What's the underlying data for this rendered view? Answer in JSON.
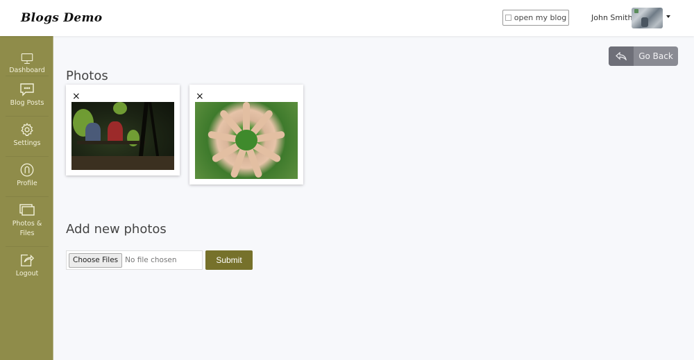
{
  "header": {
    "logo": "Blogs Demo",
    "open_blog_label": "open my blog",
    "open_blog_icon": "external-link-icon",
    "user_name": "John Smith",
    "avatar_alt": "user-avatar-photo",
    "dropdown_icon": "caret-down-icon"
  },
  "sidebar": {
    "items": [
      {
        "label": "Dashboard",
        "icon": "monitor-icon"
      },
      {
        "label": "Blog Posts",
        "icon": "chat-bubble-icon"
      },
      {
        "label": "Settings",
        "icon": "gear-icon"
      },
      {
        "label": "Profile",
        "icon": "user-circle-icon"
      },
      {
        "label": "Photos & Files",
        "icon": "photos-stack-icon"
      },
      {
        "label": "Logout",
        "icon": "share-out-icon"
      }
    ]
  },
  "toolbar": {
    "go_back_label": "Go Back",
    "go_back_icon": "reply-arrow-icon"
  },
  "photos": {
    "title": "Photos",
    "items": [
      {
        "description": "Couple sitting on a park bench under trees",
        "remove_label": "×"
      },
      {
        "description": "Circle of hands on green grass",
        "remove_label": "×"
      }
    ]
  },
  "upload": {
    "title": "Add new photos",
    "choose_label": "Choose Files",
    "no_file_text": "No file chosen",
    "submit_label": "Submit"
  },
  "colors": {
    "sidebar_bg": "#8f8c4a",
    "submit_bg": "#76712b",
    "go_back_bg": "#8a8b93",
    "page_bg": "#f7f8fb"
  }
}
